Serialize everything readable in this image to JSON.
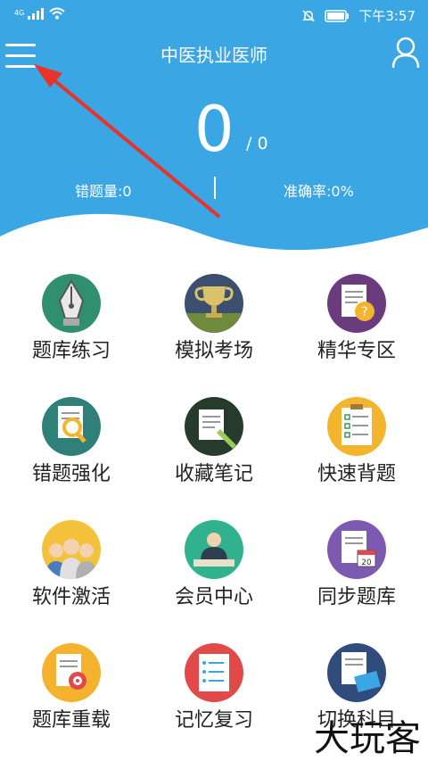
{
  "status_bar": {
    "network": "4G",
    "time": "下午3:57"
  },
  "header": {
    "title": "中医执业医师",
    "score": "0",
    "total": "/ 0",
    "wrong_count": "错题量:0",
    "accuracy": "准确率:0%",
    "bg_color": "#3aa6e4"
  },
  "grid": [
    {
      "label": "题库练习",
      "icon": "fountain-pen-icon",
      "color": "#2f8f6f"
    },
    {
      "label": "模拟考场",
      "icon": "trophy-icon",
      "color": "#3c4f6e"
    },
    {
      "label": "精华专区",
      "icon": "question-document-icon",
      "color": "#6a3b7d"
    },
    {
      "label": "错题强化",
      "icon": "magnifier-document-icon",
      "color": "#2f8079"
    },
    {
      "label": "收藏笔记",
      "icon": "notebook-pen-icon",
      "color": "#263b2c"
    },
    {
      "label": "快速背题",
      "icon": "checklist-clipboard-icon",
      "color": "#f2b52d"
    },
    {
      "label": "软件激活",
      "icon": "people-group-icon",
      "color": "#f3c23a"
    },
    {
      "label": "会员中心",
      "icon": "presenter-icon",
      "color": "#2fb28d"
    },
    {
      "label": "同步题库",
      "icon": "calendar-document-icon",
      "color": "#7c5ab0"
    },
    {
      "label": "题库重载",
      "icon": "target-document-icon",
      "color": "#f4b22e"
    },
    {
      "label": "记忆复习",
      "icon": "checklist-notepad-icon",
      "color": "#e24a4a"
    },
    {
      "label": "切换科目",
      "icon": "keyboard-document-icon",
      "color": "#2f4c7c"
    }
  ],
  "watermark": "大玩客"
}
